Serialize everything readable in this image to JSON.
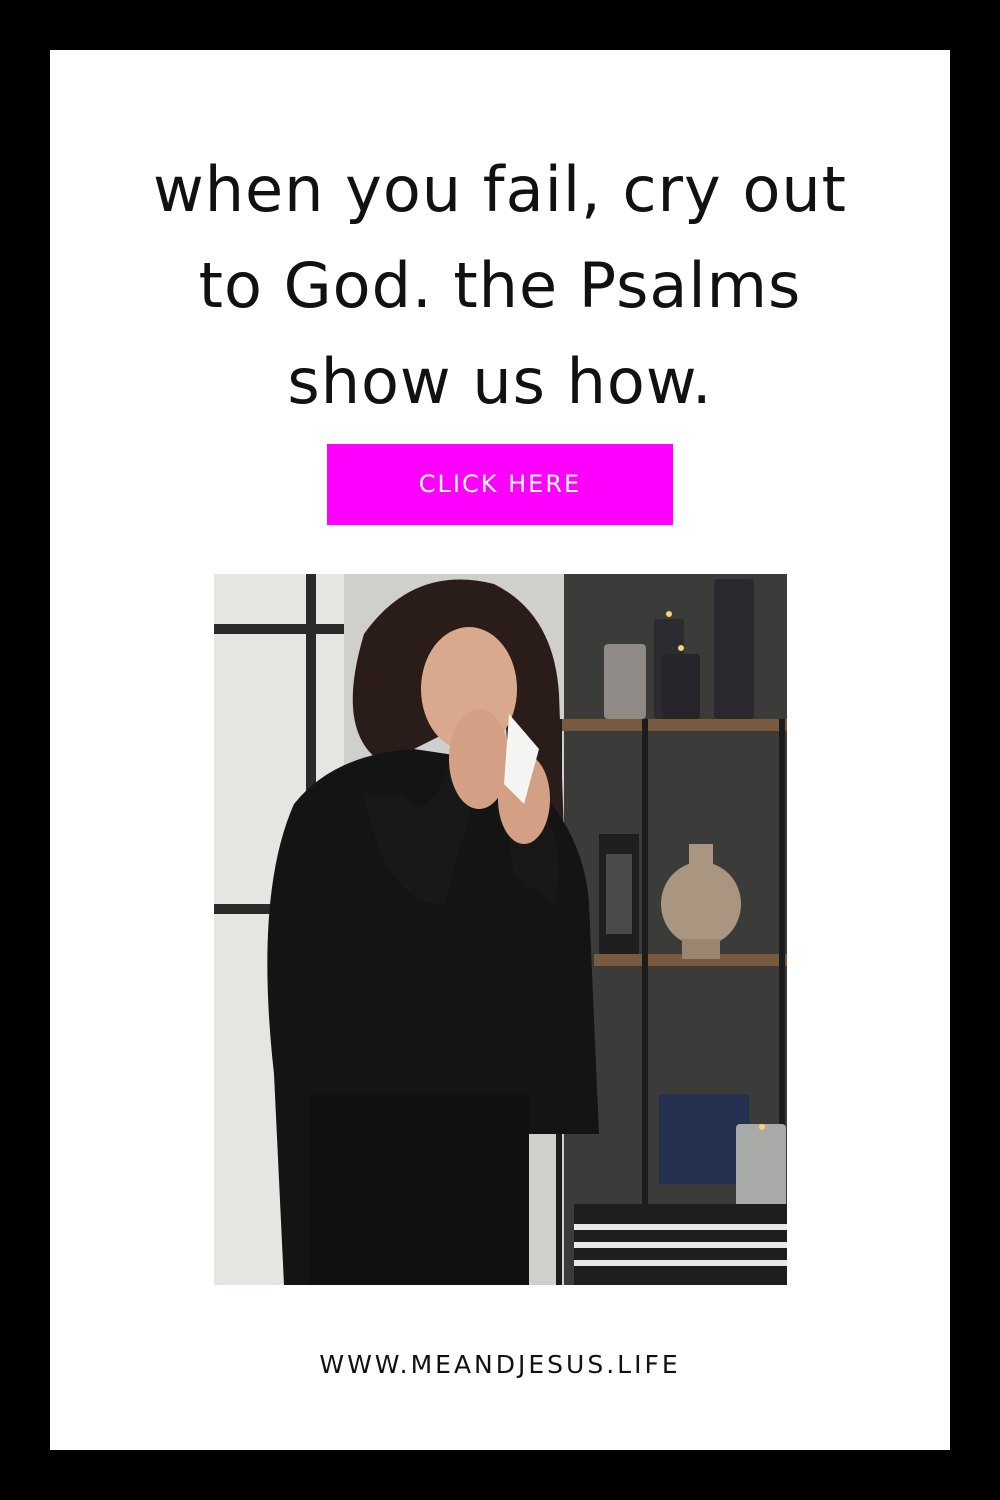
{
  "headline": {
    "lines": [
      "when you fail, cry out",
      "to God. the Psalms",
      "show us how."
    ]
  },
  "cta": {
    "label": "CLICK HERE",
    "color": "#ff00ff"
  },
  "photo": {
    "subject": "woman-crying-icon"
  },
  "footer": {
    "url": "WWW.MEANDJESUS.LIFE"
  },
  "colors": {
    "border": "#000000",
    "background": "#ffffff",
    "accent": "#ff00ff",
    "text": "#111111"
  }
}
